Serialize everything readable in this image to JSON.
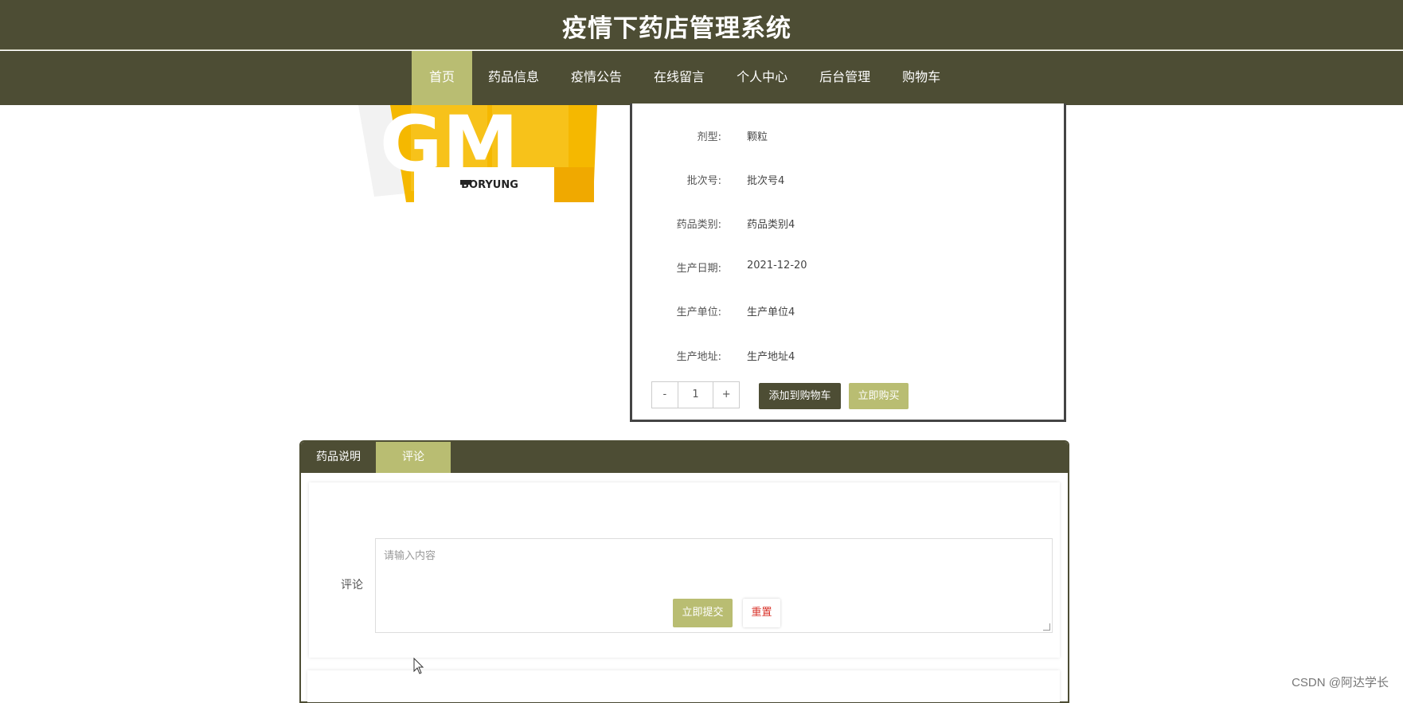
{
  "header": {
    "title": "疫情下药店管理系统"
  },
  "nav": {
    "items": [
      "首页",
      "药品信息",
      "疫情公告",
      "在线留言",
      "个人中心",
      "后台管理",
      "购物车"
    ],
    "active_index": 0
  },
  "product": {
    "image_text": "GM",
    "brand": "BORYUNG",
    "details": [
      {
        "label": "剂型:",
        "value": "颗粒"
      },
      {
        "label": "批次号:",
        "value": "批次号4"
      },
      {
        "label": "药品类别:",
        "value": "药品类别4"
      },
      {
        "label": "生产日期:",
        "value": "2021-12-20"
      },
      {
        "label": "生产单位:",
        "value": "生产单位4"
      },
      {
        "label": "生产地址:",
        "value": "生产地址4"
      }
    ],
    "quantity": {
      "minus": "-",
      "value": "1",
      "plus": "+"
    },
    "add_to_cart": "添加到购物车",
    "buy_now": "立即购买"
  },
  "tabs": {
    "description": "药品说明",
    "comment": "评论",
    "active": "comment"
  },
  "comment_form": {
    "label": "评论",
    "placeholder": "请输入内容",
    "submit": "立即提交",
    "reset": "重置"
  },
  "watermark": "CSDN @阿达学长",
  "colors": {
    "header_bg": "#4d4d34",
    "accent": "#b9bd72",
    "reset_text": "#d9342b"
  }
}
